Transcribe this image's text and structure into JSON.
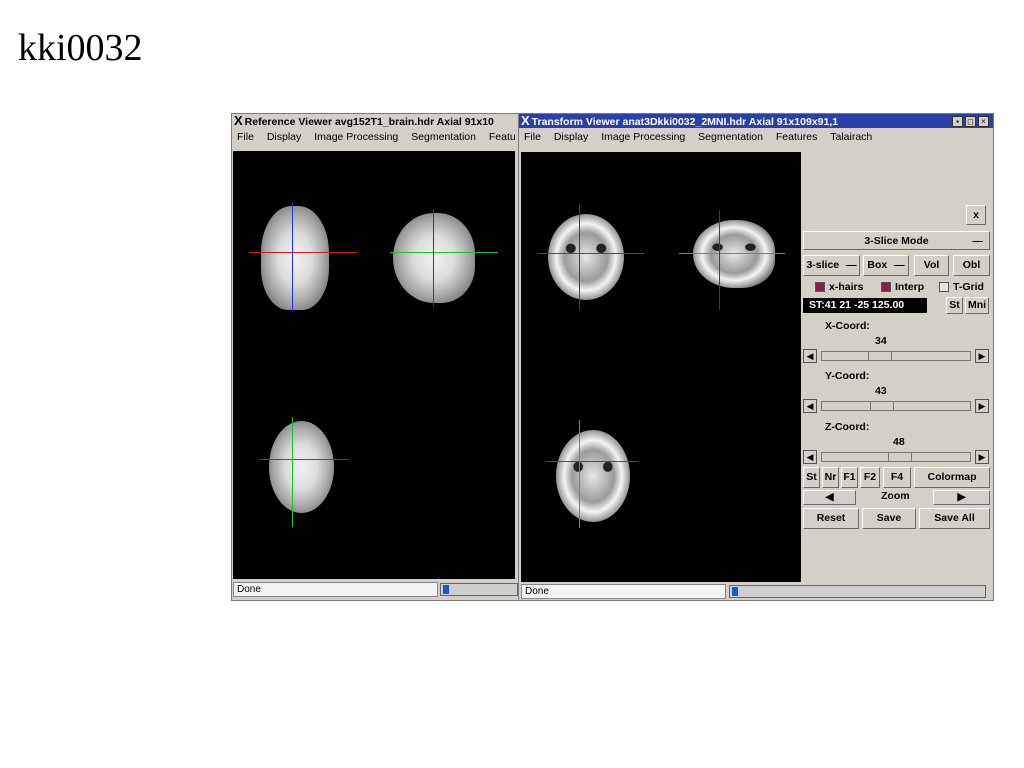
{
  "slide": {
    "title": "kki0032"
  },
  "reference_viewer": {
    "title": "Reference Viewer avg152T1_brain.hdr Axial 91x10",
    "menu": [
      "File",
      "Display",
      "Image Processing",
      "Segmentation",
      "Featu"
    ],
    "status": "Done",
    "crosshair_colors": {
      "horizontal": "#d01a1a",
      "vertical": "#2233dd",
      "green": "#1fbf2a"
    }
  },
  "transform_viewer": {
    "title": "Transform Viewer anat3Dkki0032_2MNI.hdr Axial 91x109x91,1",
    "title_bg": "#2b3fa8",
    "menu": [
      "File",
      "Display",
      "Image Processing",
      "Segmentation",
      "Features",
      "Talairach"
    ],
    "status": "Done",
    "window_buttons": [
      "▪",
      "◻",
      "×"
    ]
  },
  "controls": {
    "close_label": "x",
    "mode_label": "3-Slice Mode",
    "slice_label": "3-slice",
    "box_label": "Box",
    "vol_label": "Vol",
    "obl_label": "Obl",
    "xhairs_label": "x-hairs",
    "interp_label": "Interp",
    "tgrid_label": "T-Grid",
    "readout": "ST:41 21 -25 125.00",
    "st_label": "St",
    "mni_label": "Mni",
    "x_coord": {
      "label": "X-Coord:",
      "value": "34",
      "level": 0.37
    },
    "y_coord": {
      "label": "Y-Coord:",
      "value": "43",
      "level": 0.39
    },
    "z_coord": {
      "label": "Z-Coord:",
      "value": "48",
      "level": 0.53
    },
    "bottom_buttons": [
      "St",
      "Nr",
      "F1",
      "F2",
      "F4"
    ],
    "colormap_label": "Colormap",
    "zoom_left": "◀",
    "zoom_label": "Zoom",
    "zoom_right": "▶",
    "reset_label": "Reset",
    "save_label": "Save",
    "save_all_label": "Save All",
    "arrow_left": "◀",
    "arrow_right": "▶",
    "dropdown_icon": "—"
  }
}
